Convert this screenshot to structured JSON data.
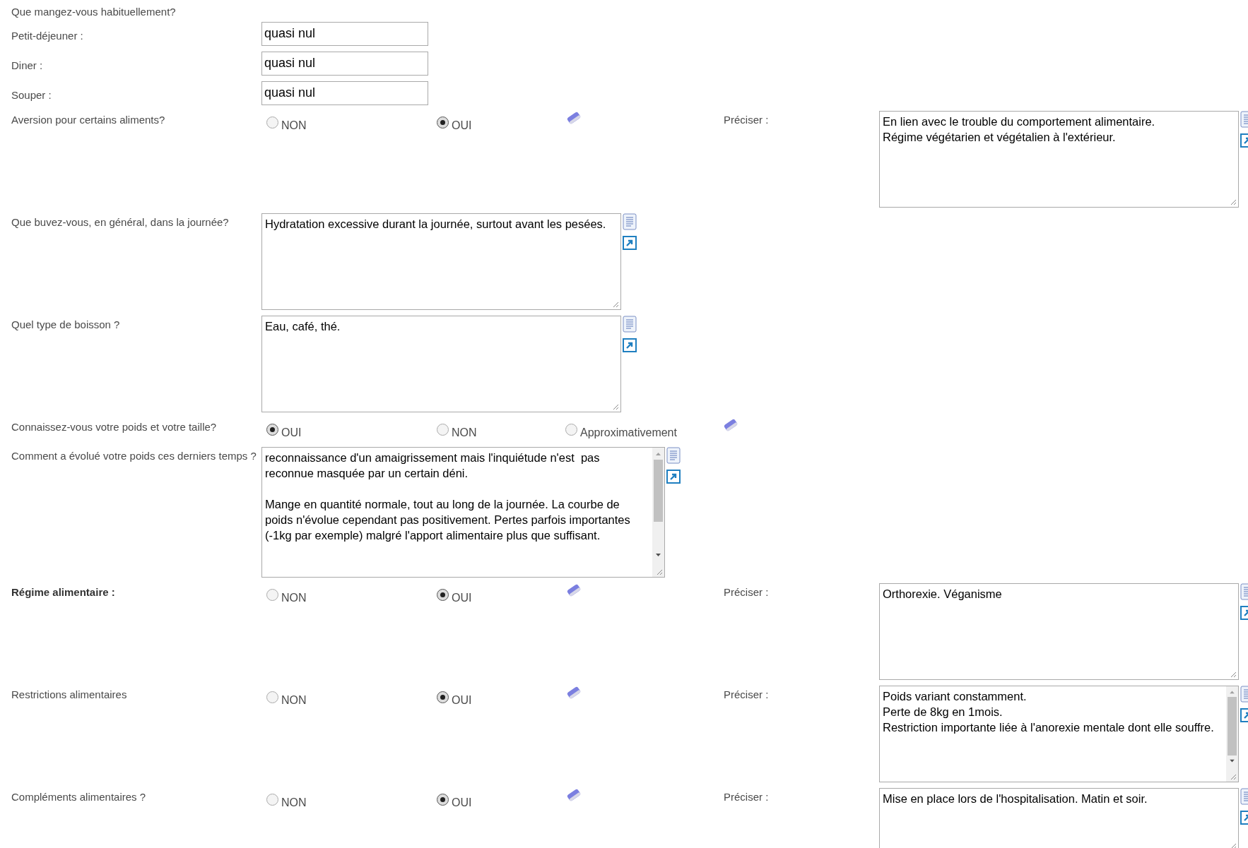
{
  "heading": "Que mangez-vous habituellement?",
  "rows": [
    {
      "kind": "text",
      "label": "Petit-déjeuner :",
      "value": "quasi nul"
    },
    {
      "kind": "text",
      "label": "Diner :",
      "value": "quasi nul"
    },
    {
      "kind": "text",
      "label": "Souper :",
      "value": "quasi nul"
    },
    {
      "kind": "choice",
      "label": "Aversion pour certains aliments?",
      "options": [
        {
          "label": "NON",
          "selected": false
        },
        {
          "label": "OUI",
          "selected": true
        }
      ],
      "detail": {
        "label": "Préciser :",
        "value": "En lien avec le trouble du comportement alimentaire.\nRégime végétarien et végétalien à l'extérieur."
      }
    },
    {
      "kind": "memo",
      "label": "Que buvez-vous, en général, dans la journée?",
      "value": "Hydratation excessive durant la journée, surtout avant les pesées."
    },
    {
      "kind": "memo",
      "label": "Quel type de boisson ?",
      "value": "Eau, café, thé."
    },
    {
      "kind": "choice",
      "label": "Connaissez-vous votre poids et votre taille?",
      "options": [
        {
          "label": "OUI",
          "selected": true
        },
        {
          "label": "NON",
          "selected": false
        },
        {
          "label": "Approximativement",
          "selected": false
        }
      ]
    },
    {
      "kind": "memo",
      "label": "Comment a évolué votre poids ces derniers temps ?",
      "value": "reconnaissance d'un amaigrissement mais l'inquiétude n'est  pas reconnue masquée par un certain déni.\n\nMange en quantité normale, tout au long de la journée. La courbe de poids n'évolue cependant pas positivement. Pertes parfois importantes (-1kg par exemple) malgré l'apport alimentaire plus que suffisant.",
      "scrollable": true
    },
    {
      "kind": "choice",
      "label": "Régime alimentaire :",
      "bold": true,
      "options": [
        {
          "label": "NON",
          "selected": false
        },
        {
          "label": "OUI",
          "selected": true
        }
      ],
      "detail": {
        "label": "Préciser :",
        "value": "Orthorexie. Véganisme"
      }
    },
    {
      "kind": "choice",
      "label": "Restrictions alimentaires",
      "options": [
        {
          "label": "NON",
          "selected": false
        },
        {
          "label": "OUI",
          "selected": true
        }
      ],
      "detail": {
        "label": "Préciser :",
        "value": "Poids variant constamment.\nPerte de 8kg en 1mois.\nRestriction importante liée à l'anorexie mentale dont elle souffre.",
        "scrollable": true
      }
    },
    {
      "kind": "choice",
      "label": "Compléments alimentaires ?",
      "options": [
        {
          "label": "NON",
          "selected": false
        },
        {
          "label": "OUI",
          "selected": true
        }
      ],
      "detail": {
        "label": "Préciser :",
        "value": "Mise en place lors de l'hospitalisation. Matin et soir."
      }
    }
  ]
}
